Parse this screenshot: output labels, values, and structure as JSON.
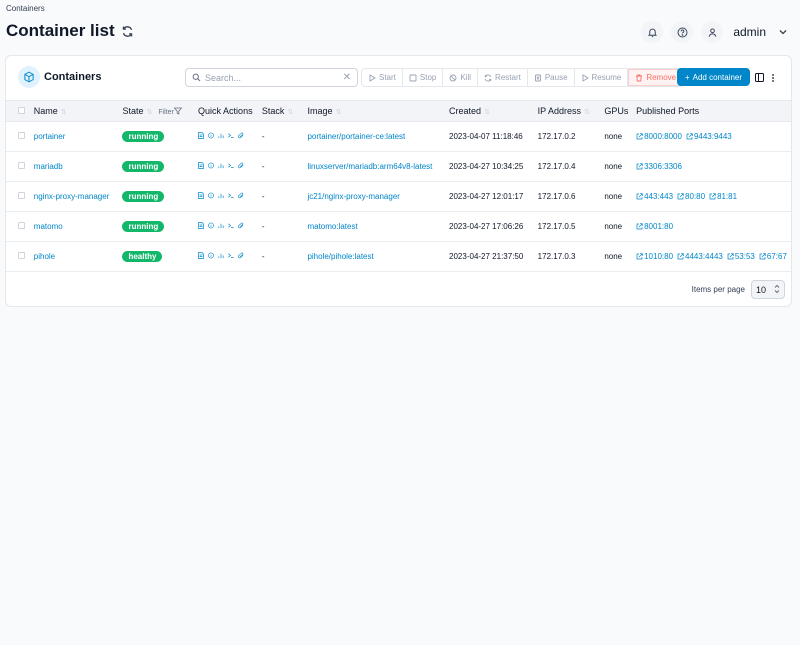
{
  "breadcrumb": "Containers",
  "page_title": "Container list",
  "user": {
    "name": "admin"
  },
  "card": {
    "title": "Containers",
    "search_placeholder": "Search...",
    "actions": {
      "start": "Start",
      "stop": "Stop",
      "kill": "Kill",
      "restart": "Restart",
      "pause": "Pause",
      "resume": "Resume",
      "remove": "Remove"
    },
    "add_label": "Add container"
  },
  "columns": {
    "name": "Name",
    "state": "State",
    "filter": "Filter",
    "quick_actions": "Quick Actions",
    "stack": "Stack",
    "image": "Image",
    "created": "Created",
    "ip": "IP Address",
    "gpus": "GPUs",
    "ports": "Published Ports"
  },
  "rows": [
    {
      "name": "portainer",
      "state": "running",
      "stack": "-",
      "image": "portainer/portainer-ce:latest",
      "created": "2023-04-07 11:18:46",
      "ip": "172.17.0.2",
      "gpus": "none",
      "ports": [
        "8000:8000",
        "9443:9443"
      ]
    },
    {
      "name": "mariadb",
      "state": "running",
      "stack": "-",
      "image": "linuxserver/mariadb:arm64v8-latest",
      "created": "2023-04-27 10:34:25",
      "ip": "172.17.0.4",
      "gpus": "none",
      "ports": [
        "3306:3306"
      ]
    },
    {
      "name": "nginx-proxy-manager",
      "state": "running",
      "stack": "-",
      "image": "jc21/nginx-proxy-manager",
      "created": "2023-04-27 12:01:17",
      "ip": "172.17.0.6",
      "gpus": "none",
      "ports": [
        "443:443",
        "80:80",
        "81:81"
      ]
    },
    {
      "name": "matomo",
      "state": "running",
      "stack": "-",
      "image": "matomo:latest",
      "created": "2023-04-27 17:06:26",
      "ip": "172.17.0.5",
      "gpus": "none",
      "ports": [
        "8001:80"
      ]
    },
    {
      "name": "pihole",
      "state": "healthy",
      "stack": "-",
      "image": "pihole/pihole:latest",
      "created": "2023-04-27 21:37:50",
      "ip": "172.17.0.3",
      "gpus": "none",
      "ports": [
        "1010:80",
        "4443:4443",
        "53:53",
        "67:67"
      ]
    }
  ],
  "pagination": {
    "label": "Items per page",
    "value": "10"
  },
  "colors": {
    "accent": "#0086c9",
    "status_green": "#12b76a",
    "remove_red": "#f97066"
  }
}
